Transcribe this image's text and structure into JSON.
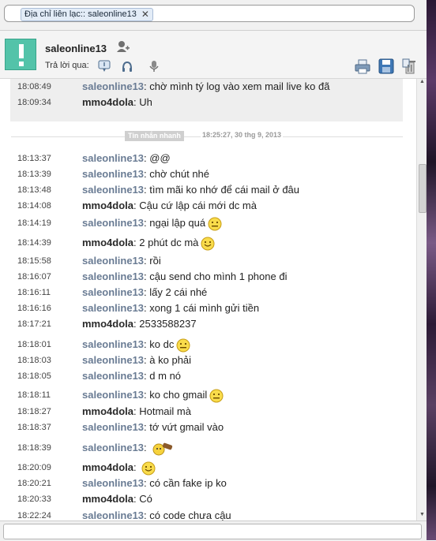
{
  "address_bar": {
    "chip_text": "Địa chỉ liên lạc:: saleonline13"
  },
  "header": {
    "contact_name": "saleonline13",
    "reply_label": "Trả lời qua:"
  },
  "previous_messages": [
    {
      "time": "18:08:49",
      "sender": "saleonline13",
      "text": "chờ mình tý log vào xem mail live ko đã"
    },
    {
      "time": "18:09:34",
      "sender": "mmo4dola",
      "text": "Uh"
    }
  ],
  "divider": {
    "label": "Tin nhắn nhanh",
    "timestamp": "18:25:27, 30 thg 9, 2013"
  },
  "messages": [
    {
      "time": "18:13:37",
      "sender": "saleonline13",
      "text": "@@",
      "emoji": ""
    },
    {
      "time": "18:13:39",
      "sender": "saleonline13",
      "text": "chờ chút nhé",
      "emoji": ""
    },
    {
      "time": "18:13:48",
      "sender": "saleonline13",
      "text": "tìm mãi ko nhớ để cái mail ở đâu",
      "emoji": ""
    },
    {
      "time": "18:14:08",
      "sender": "mmo4dola",
      "text": "Cậu cứ lập cái mới dc mà",
      "emoji": ""
    },
    {
      "time": "18:14:19",
      "sender": "saleonline13",
      "text": "ngại lập quá",
      "emoji": "meh"
    },
    {
      "time": "18:14:39",
      "sender": "mmo4dola",
      "text": "2 phút dc mà",
      "emoji": "smile"
    },
    {
      "time": "18:15:58",
      "sender": "saleonline13",
      "text": "rồi",
      "emoji": ""
    },
    {
      "time": "18:16:07",
      "sender": "saleonline13",
      "text": "cậu send cho mình 1 phone đi",
      "emoji": ""
    },
    {
      "time": "18:16:11",
      "sender": "saleonline13",
      "text": "lấy 2 cái nhé",
      "emoji": ""
    },
    {
      "time": "18:16:16",
      "sender": "saleonline13",
      "text": "xong 1 cái mình gửi tiền",
      "emoji": ""
    },
    {
      "time": "18:17:21",
      "sender": "mmo4dola",
      "text": "2533588237",
      "emoji": ""
    },
    {
      "time": "18:18:01",
      "sender": "saleonline13",
      "text": "ko dc",
      "emoji": "meh"
    },
    {
      "time": "18:18:03",
      "sender": "saleonline13",
      "text": "à ko phải",
      "emoji": ""
    },
    {
      "time": "18:18:05",
      "sender": "saleonline13",
      "text": "d m nó",
      "emoji": ""
    },
    {
      "time": "18:18:11",
      "sender": "saleonline13",
      "text": "ko cho gmail",
      "emoji": "meh"
    },
    {
      "time": "18:18:27",
      "sender": "mmo4dola",
      "text": "Hotmail mà",
      "emoji": ""
    },
    {
      "time": "18:18:37",
      "sender": "saleonline13",
      "text": "tớ vứt gmail vào",
      "emoji": ""
    },
    {
      "time": "18:18:39",
      "sender": "saleonline13",
      "text": "",
      "emoji": "bash"
    },
    {
      "time": "18:20:09",
      "sender": "mmo4dola",
      "text": "",
      "emoji": "smile"
    },
    {
      "time": "18:20:21",
      "sender": "saleonline13",
      "text": "có cần fake ip ko",
      "emoji": ""
    },
    {
      "time": "18:20:33",
      "sender": "mmo4dola",
      "text": "Có",
      "emoji": ""
    },
    {
      "time": "18:22:24",
      "sender": "saleonline13",
      "text": "có code chưa cậu",
      "emoji": ""
    }
  ],
  "colors": {
    "saleonline_name": "#6a7c94",
    "mmo_name": "#2a2a2a",
    "avatar_bg": "#53c3a9"
  }
}
